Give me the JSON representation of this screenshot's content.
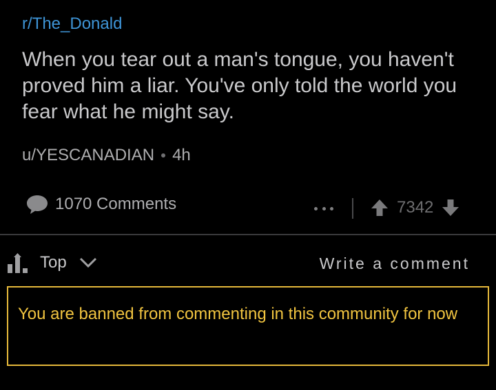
{
  "post": {
    "subreddit": "r/The_Donald",
    "title": "When you tear out a man's tongue, you haven't proved him a liar. You've only told the world you fear what he might say.",
    "author": "u/YESCANADIAN",
    "age": "4h",
    "comments_label": "1070 Comments",
    "score": "7342"
  },
  "icons": {
    "comment": "comment-bubble-icon",
    "more": "more-dots-icon",
    "upvote": "upvote-arrow-icon",
    "downvote": "downvote-arrow-icon",
    "sort": "sort-bars-icon",
    "chevron": "chevron-down-icon"
  },
  "comments_bar": {
    "sort_label": "Top",
    "write_label": "Write a comment"
  },
  "notice": {
    "text": "You are banned from commenting in this community for now"
  },
  "colors": {
    "background": "#000000",
    "link": "#3e94d6",
    "title_text": "#c9c9cb",
    "muted_text": "#aeaeb0",
    "notice": "#e6b93b"
  }
}
